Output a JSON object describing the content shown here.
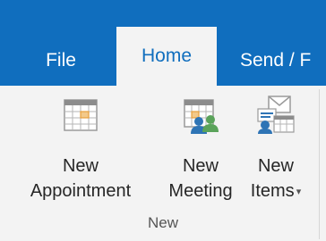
{
  "tabs": {
    "file": "File",
    "home": "Home",
    "send": "Send / F"
  },
  "buttons": {
    "new_appointment": {
      "line1": "New",
      "line2": "Appointment",
      "icon": "calendar-icon"
    },
    "new_meeting": {
      "line1": "New",
      "line2": "Meeting",
      "icon": "meeting-icon"
    },
    "new_items": {
      "line1": "New",
      "line2": "Items",
      "icon": "new-items-icon"
    }
  },
  "group": {
    "label": "New"
  },
  "colors": {
    "accent": "#106ebe",
    "calendar_orange": "#e8a03c",
    "people_blue": "#2e74b5",
    "people_green": "#5aa35a"
  }
}
